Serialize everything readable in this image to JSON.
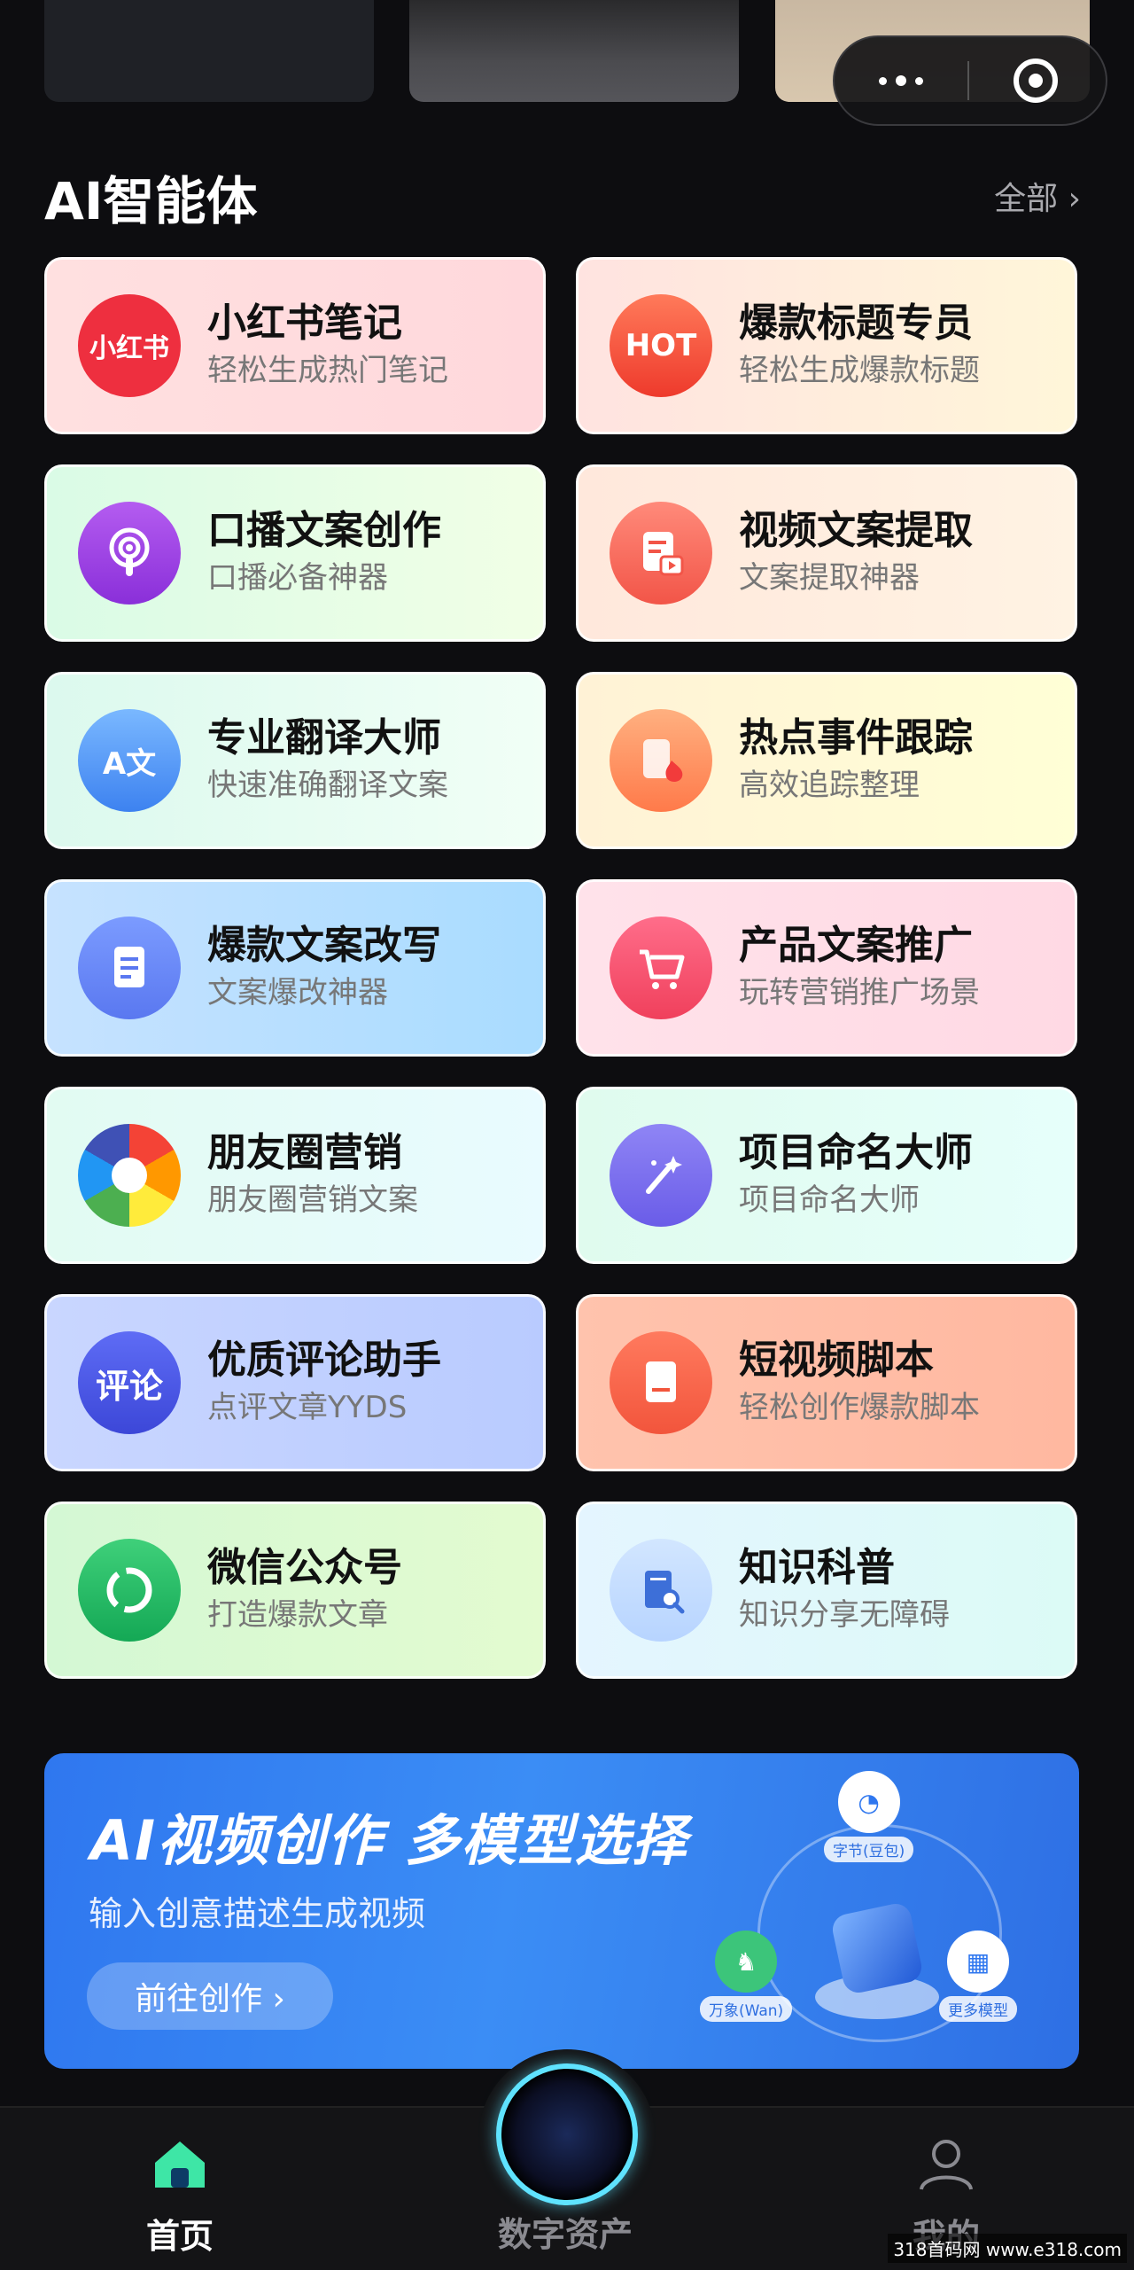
{
  "capsule": {
    "more_icon": "more-dots-icon",
    "close_icon": "target-icon"
  },
  "section": {
    "title": "AI智能体",
    "see_all": "全部 ›"
  },
  "agents": [
    {
      "title": "小红书笔记",
      "subtitle": "轻松生成热门笔记",
      "icon": "小红书",
      "bg": "#ffe3e3"
    },
    {
      "title": "爆款标题专员",
      "subtitle": "轻松生成爆款标题",
      "icon": "HOT",
      "bg": "#fff1df"
    },
    {
      "title": "口播文案创作",
      "subtitle": "口播必备神器",
      "icon": "podcast",
      "bg": "#e6fbe9"
    },
    {
      "title": "视频文案提取",
      "subtitle": "文案提取神器",
      "icon": "video-doc",
      "bg": "#ffeede"
    },
    {
      "title": "专业翻译大师",
      "subtitle": "快速准确翻译文案",
      "icon": "A文",
      "bg": "#e4fbf3"
    },
    {
      "title": "热点事件跟踪",
      "subtitle": "高效追踪整理",
      "icon": "fire-doc",
      "bg": "#fffbd9"
    },
    {
      "title": "爆款文案改写",
      "subtitle": "文案爆改神器",
      "icon": "doc",
      "bg": "#cde7ff"
    },
    {
      "title": "产品文案推广",
      "subtitle": "玩转营销推广场景",
      "icon": "cart",
      "bg": "#ffe3ea"
    },
    {
      "title": "朋友圈营销",
      "subtitle": "朋友圈营销文案",
      "icon": "aperture",
      "bg": "#e8fbf6"
    },
    {
      "title": "项目命名大师",
      "subtitle": "项目命名大师",
      "icon": "brush",
      "bg": "#e4fbf3"
    },
    {
      "title": "优质评论助手",
      "subtitle": "点评文章YYDS",
      "icon": "评论",
      "bg": "#cfd8ff"
    },
    {
      "title": "短视频脚本",
      "subtitle": "轻松创作爆款脚本",
      "icon": "script",
      "bg": "#ffc9b3"
    },
    {
      "title": "微信公众号",
      "subtitle": "打造爆款文章",
      "icon": "wechat",
      "bg": "#d9f9d6"
    },
    {
      "title": "知识科普",
      "subtitle": "知识分享无障碍",
      "icon": "book-search",
      "bg": "#e3f7ff"
    }
  ],
  "banner": {
    "headline": "AI视频创作 多模型选择",
    "subtitle": "输入创意描述生成视频",
    "button": "前往创作 ›",
    "nodes": [
      "字节(豆包)",
      "万象(Wan)",
      "更多模型"
    ]
  },
  "nav": {
    "home": "首页",
    "assets": "数字资产",
    "mine": "我的"
  },
  "watermark": "318首码网 www.e318.com"
}
